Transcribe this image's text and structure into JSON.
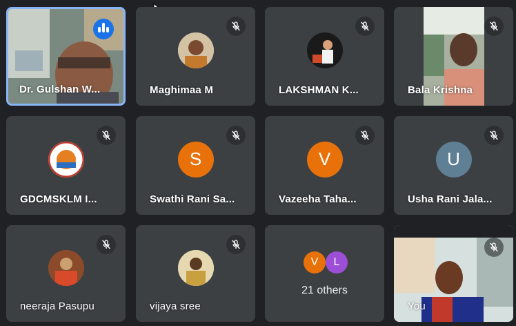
{
  "participants": [
    {
      "name": "Dr. Gulshan W...",
      "speaking": true
    },
    {
      "name": "Maghimaa M",
      "muted": true
    },
    {
      "name": "LAKSHMAN K...",
      "muted": true
    },
    {
      "name": "Bala Krishna",
      "muted": true
    },
    {
      "name": "GDCMSKLM I...",
      "muted": true
    },
    {
      "name": "Swathi Rani Sa...",
      "muted": true,
      "initial": "S",
      "avatar_color": "#e8710a"
    },
    {
      "name": "Vazeeha Taha...",
      "muted": true,
      "initial": "V",
      "avatar_color": "#e8710a"
    },
    {
      "name": "Usha Rani Jala...",
      "muted": true,
      "initial": "U",
      "avatar_color": "#5f7f95"
    },
    {
      "name": "neeraja Pasupu",
      "muted": true
    },
    {
      "name": "vijaya sree",
      "muted": true
    },
    {
      "name": "You",
      "muted": true
    }
  ],
  "others": {
    "count_label": "21 others",
    "initials": [
      "V",
      "L"
    ],
    "colors": [
      "#e8710a",
      "#9c4fd6"
    ]
  },
  "icons": {
    "mute": "mic-off-icon",
    "speaking": "audio-bars-icon",
    "cursor": "mouse-pointer-icon"
  }
}
